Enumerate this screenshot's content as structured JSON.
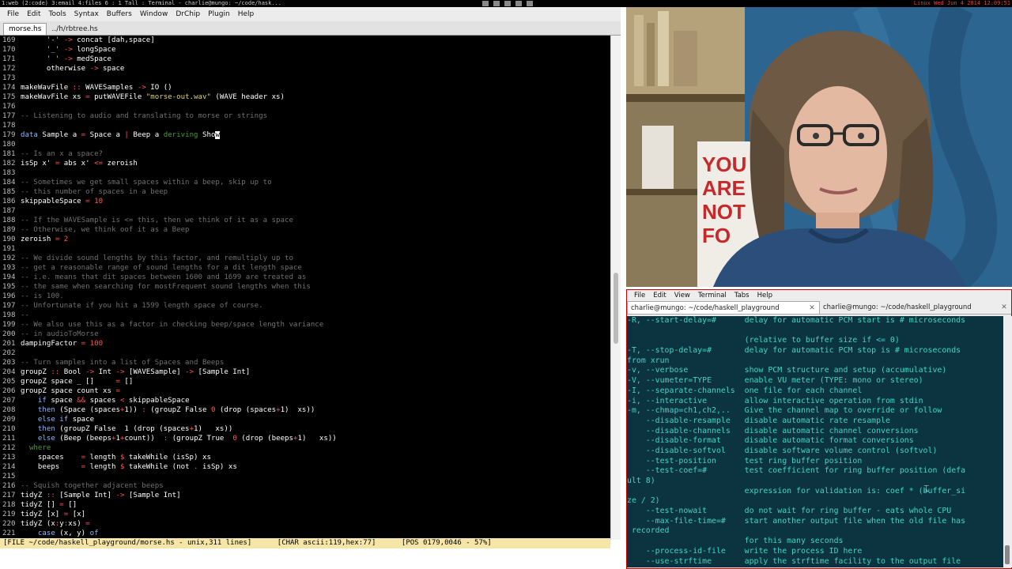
{
  "topbar": {
    "left": "1:web (2:code) 3:email 4:files 6 : 1 Tall : Terminal - charlie@mungo: ~/code/hask...",
    "os": "Linux",
    "datetime": "Wed Jun 4 2014 12:09:51"
  },
  "editor": {
    "menu": [
      "File",
      "Edit",
      "Tools",
      "Syntax",
      "Buffers",
      "Window",
      "DrChip",
      "Plugin",
      "Help"
    ],
    "tabs": [
      "morse.hs",
      "../h/rbtree.hs"
    ],
    "modeline": "[FILE ~/code/haskell_playground/morse.hs - unix,311 lines]      [CHAR ascii:119,hex:77]      [POS 0179,0046 - 57%]",
    "lines": [
      {
        "n": "169",
        "html": "      <span class=\"s\">'-'</span> <span class=\"o\">-&gt;</span> concat [dah,space]"
      },
      {
        "n": "170",
        "html": "      <span class=\"s\">'_'</span> <span class=\"o\">-&gt;</span> longSpace"
      },
      {
        "n": "171",
        "html": "      <span class=\"s\">' '</span> <span class=\"o\">-&gt;</span> medSpace"
      },
      {
        "n": "172",
        "html": "      otherwise <span class=\"o\">-&gt;</span> space"
      },
      {
        "n": "173",
        "html": ""
      },
      {
        "n": "174",
        "html": "makeWavFile <span class=\"o\">::</span> WAVESamples <span class=\"o\">-&gt;</span> IO ()"
      },
      {
        "n": "175",
        "html": "makeWavFile xs <span class=\"o\">=</span> putWAVEFile <span class=\"s\">\"morse-out.wav\"</span> (WAVE header xs)"
      },
      {
        "n": "176",
        "html": ""
      },
      {
        "n": "177",
        "html": "<span class=\"c1\">-- Listening to audio and translating to morse or strings</span>"
      },
      {
        "n": "178",
        "html": ""
      },
      {
        "n": "179",
        "html": "<span class=\"k\">data</span> Sample a <span class=\"o\">=</span> Space a <span class=\"o\">|</span> Beep a <span class=\"d\">deriving</span> Sho<span class=\"cursor\">w</span>"
      },
      {
        "n": "180",
        "html": ""
      },
      {
        "n": "181",
        "html": "<span class=\"c1\">-- Is an x a space?</span>"
      },
      {
        "n": "182",
        "html": "isSp x' <span class=\"o\">=</span> abs x' <span class=\"o\">&lt;=</span> zeroish"
      },
      {
        "n": "183",
        "html": ""
      },
      {
        "n": "184",
        "html": "<span class=\"c1\">-- Sometimes we get small spaces within a beep, skip up to</span>"
      },
      {
        "n": "185",
        "html": "<span class=\"c1\">-- this number of spaces in a beep</span>"
      },
      {
        "n": "186",
        "html": "skippableSpace <span class=\"o\">=</span> <span class=\"o\">10</span>"
      },
      {
        "n": "187",
        "html": ""
      },
      {
        "n": "188",
        "html": "<span class=\"c1\">-- If the WAVESample is &lt;= this, then we think of it as a space</span>"
      },
      {
        "n": "189",
        "html": "<span class=\"c1\">-- Otherwise, we think oof it as a Beep</span>"
      },
      {
        "n": "190",
        "html": "zeroish <span class=\"o\">=</span> <span class=\"o\">2</span>"
      },
      {
        "n": "191",
        "html": ""
      },
      {
        "n": "192",
        "html": "<span class=\"c1\">-- We divide sound lengths by this factor, and remultiply up to</span>"
      },
      {
        "n": "193",
        "html": "<span class=\"c1\">-- get a reasonable range of sound lengths for a dit length space</span>"
      },
      {
        "n": "194",
        "html": "<span class=\"c1\">-- i.e. means that dit spaces between 1600 and 1699 are treated as</span>"
      },
      {
        "n": "195",
        "html": "<span class=\"c1\">-- the same when searching for mostFrequent sound lengths when this</span>"
      },
      {
        "n": "196",
        "html": "<span class=\"c1\">-- is 100.</span>"
      },
      {
        "n": "197",
        "html": "<span class=\"c1\">-- Unfortunate if you hit a 1599 length space of course.</span>"
      },
      {
        "n": "198",
        "html": "<span class=\"c1\">--</span>"
      },
      {
        "n": "199",
        "html": "<span class=\"c1\">-- We also use this as a factor in checking beep/space length variance</span>"
      },
      {
        "n": "200",
        "html": "<span class=\"c1\">-- in audioToMorse</span>"
      },
      {
        "n": "201",
        "html": "dampingFactor <span class=\"o\">=</span> <span class=\"o\">100</span>"
      },
      {
        "n": "202",
        "html": ""
      },
      {
        "n": "203",
        "html": "<span class=\"c1\">-- Turn samples into a list of Spaces and Beeps</span>"
      },
      {
        "n": "204",
        "html": "groupZ <span class=\"o\">::</span> Bool <span class=\"o\">-&gt;</span> Int <span class=\"o\">-&gt;</span> [WAVESample] <span class=\"o\">-&gt;</span> [Sample Int]"
      },
      {
        "n": "205",
        "html": "groupZ space _ []     <span class=\"o\">=</span> []"
      },
      {
        "n": "206",
        "html": "groupZ space count xs <span class=\"o\">=</span>"
      },
      {
        "n": "207",
        "html": "    <span class=\"k\">if</span> space <span class=\"o\">&amp;&amp;</span> spaces <span class=\"o\">&lt;</span> skippableSpace"
      },
      {
        "n": "208",
        "html": "    <span class=\"k\">then</span> (Space (spaces<span class=\"o\">+</span>1)) <span class=\"o\">:</span> (groupZ False <span class=\"o\">0</span> (drop (spaces<span class=\"o\">+</span>1)  xs))"
      },
      {
        "n": "209",
        "html": "    <span class=\"k\">else</span> <span class=\"k\">if</span> space"
      },
      {
        "n": "210",
        "html": "    <span class=\"k\">then</span> (groupZ False  1 (drop (spaces<span class=\"o\">+</span>1)   xs))"
      },
      {
        "n": "211",
        "html": "    <span class=\"k\">else</span> (Beep (beeps<span class=\"o\">+</span>1<span class=\"o\">+</span>count))  <span class=\"o\">:</span> (groupZ True  <span class=\"o\">0</span> (drop (beeps<span class=\"o\">+</span>1)   xs))"
      },
      {
        "n": "212",
        "html": "  <span class=\"d\">where</span>"
      },
      {
        "n": "213",
        "html": "    spaces    <span class=\"o\">=</span> length <span class=\"o\">$</span> takeWhile (isSp) xs"
      },
      {
        "n": "214",
        "html": "    beeps     <span class=\"o\">=</span> length <span class=\"o\">$</span> takeWhile (not <span class=\"o\">.</span> isSp) xs"
      },
      {
        "n": "215",
        "html": ""
      },
      {
        "n": "216",
        "html": "<span class=\"c1\">-- Squish together adjacent beeps</span>"
      },
      {
        "n": "217",
        "html": "tidyZ <span class=\"o\">::</span> [Sample Int] <span class=\"o\">-&gt;</span> [Sample Int]"
      },
      {
        "n": "218",
        "html": "tidyZ [] <span class=\"o\">=</span> []"
      },
      {
        "n": "219",
        "html": "tidyZ [x] <span class=\"o\">=</span> [x]"
      },
      {
        "n": "220",
        "html": "tidyZ (x<span class=\"o\">:</span>y<span class=\"o\">:</span>xs) <span class=\"o\">=</span>"
      },
      {
        "n": "221",
        "html": "    <span class=\"k\">case</span> (x, y) <span class=\"k\">of</span>"
      }
    ]
  },
  "terminal": {
    "menu": [
      "File",
      "Edit",
      "View",
      "Terminal",
      "Tabs",
      "Help"
    ],
    "tabs": [
      "charlie@mungo: ~/code/haskell_playground",
      "charlie@mungo: ~/code/haskell_playground"
    ],
    "lines": [
      "-R, --start-delay=#      delay for automatic PCM start is # microseconds",
      "",
      "                         (relative to buffer size if <= 0)",
      "-T, --stop-delay=#       delay for automatic PCM stop is # microseconds",
      "from xrun",
      "-v, --verbose            show PCM structure and setup (accumulative)",
      "-V, --vumeter=TYPE       enable VU meter (TYPE: mono or stereo)",
      "-I, --separate-channels  one file for each channel",
      "-i, --interactive        allow interactive operation from stdin",
      "-m, --chmap=ch1,ch2,..   Give the channel map to override or follow",
      "    --disable-resample   disable automatic rate resample",
      "    --disable-channels   disable automatic channel conversions",
      "    --disable-format     disable automatic format conversions",
      "    --disable-softvol    disable software volume control (softvol)",
      "    --test-position      test ring buffer position",
      "    --test-coef=#        test coefficient for ring buffer position (defa",
      "ult 8)",
      "                         expression for validation is: coef * (buffer_si",
      "ze / 2)",
      "    --test-nowait        do not wait for ring buffer - eats whole CPU",
      "    --max-file-time=#    start another output file when the old file has",
      " recorded",
      "                         for this many seconds",
      "    --process-id-file    write the process ID here",
      "    --use-strftime       apply the strftime facility to the output file"
    ]
  },
  "webcam": {
    "poster_lines": [
      "YOU",
      "ARE",
      "NOT",
      "FO"
    ]
  }
}
